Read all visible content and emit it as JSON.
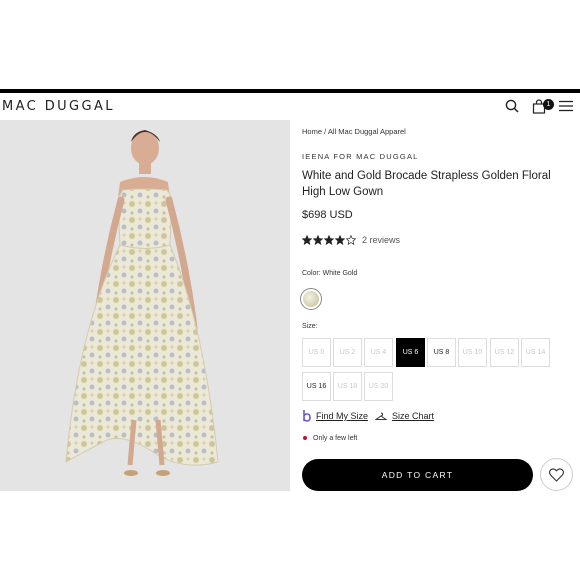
{
  "header": {
    "logo": "MAC DUGGAL",
    "icons": [
      "search-icon",
      "shopping-bag-icon",
      "hamburger-menu-icon"
    ],
    "cart_count": "1"
  },
  "product_image": {
    "icon": "dress-photo"
  },
  "breadcrumb": {
    "home": "Home",
    "separator": "/",
    "category": "All Mac Duggal Apparel"
  },
  "product": {
    "brand": "IEENA FOR MAC DUGGAL",
    "title": "White and Gold Brocade Strapless Golden Floral High Low Gown",
    "price": "$698 USD",
    "rating": 4,
    "reviews_text": "2 reviews",
    "color_label": "Color: White Gold",
    "swatch_color": "#dcd6bc",
    "size_label": "Size:",
    "sizes": [
      {
        "label": "US 0",
        "state": "unavailable"
      },
      {
        "label": "US 2",
        "state": "unavailable"
      },
      {
        "label": "US 4",
        "state": "unavailable"
      },
      {
        "label": "US 6",
        "state": "selected"
      },
      {
        "label": "US 8",
        "state": "available"
      },
      {
        "label": "US 10",
        "state": "unavailable"
      },
      {
        "label": "US 12",
        "state": "unavailable"
      },
      {
        "label": "US 14",
        "state": "unavailable"
      },
      {
        "label": "US 16",
        "state": "available"
      },
      {
        "label": "US 18",
        "state": "unavailable"
      },
      {
        "label": "US 20",
        "state": "unavailable"
      }
    ],
    "find_my_size": "Find My Size",
    "size_chart": "Size Chart",
    "stock_status": "Only a few left",
    "add_to_cart": "ADD TO CART"
  },
  "colors": {
    "accent": "#000000",
    "stock_dot": "#c8102e",
    "unavailable_text": "#c8c8c8"
  }
}
